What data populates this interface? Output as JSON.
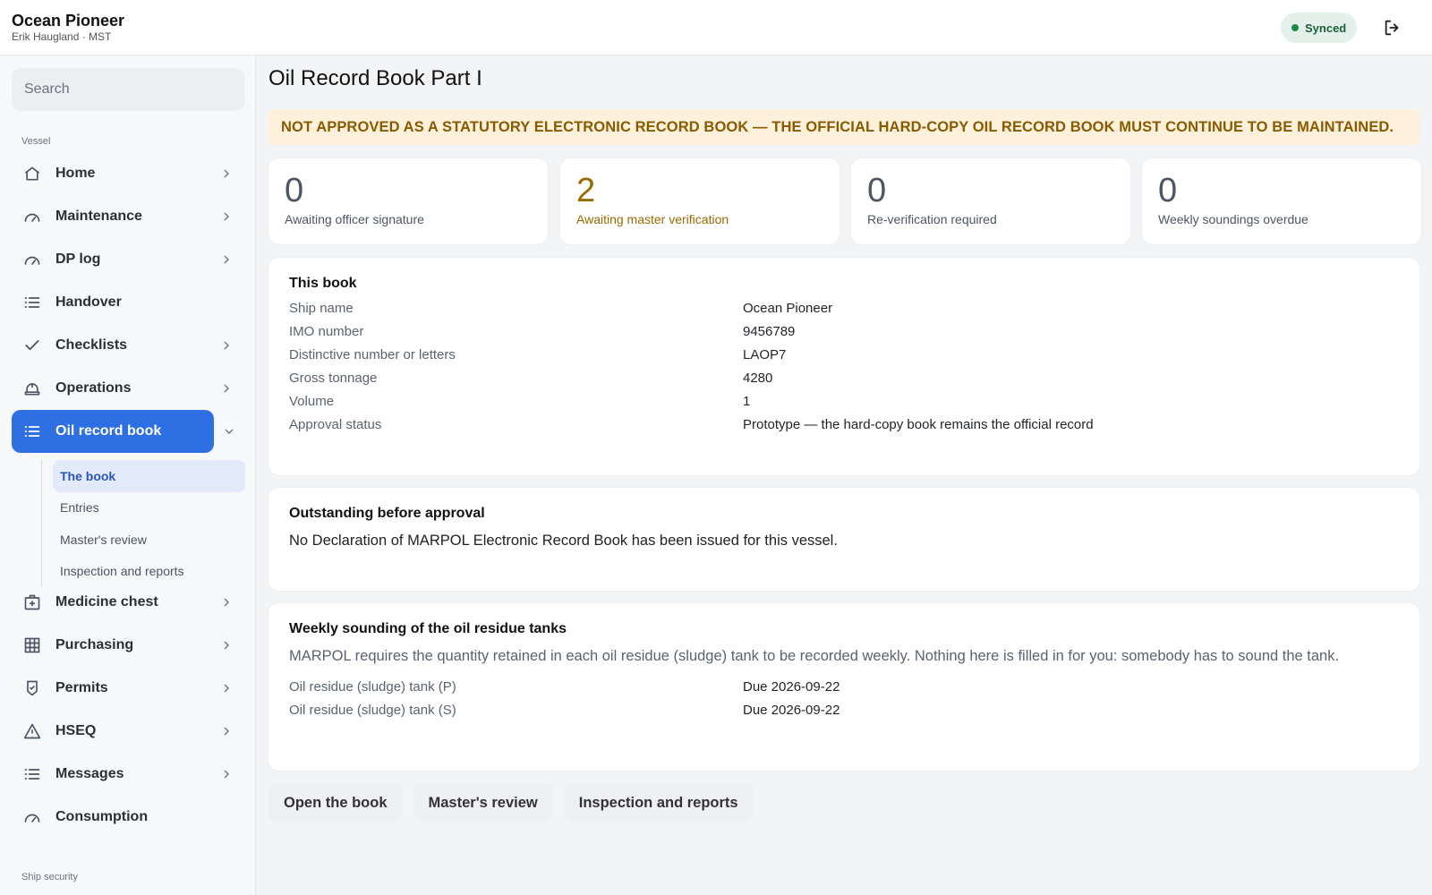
{
  "header": {
    "vessel_name": "Ocean Pioneer",
    "user_line": "Erik Haugland · MST",
    "sync_status": "Synced",
    "status_color": "#1f8a4c"
  },
  "sidebar": {
    "search_placeholder": "Search",
    "section_vessel": "Vessel",
    "section_ship_security": "Ship security",
    "items": [
      {
        "label": "Home",
        "icon": "home-icon"
      },
      {
        "label": "Maintenance",
        "icon": "gauge-icon"
      },
      {
        "label": "DP log",
        "icon": "gauge-icon"
      },
      {
        "label": "Handover",
        "icon": "list-icon"
      },
      {
        "label": "Checklists",
        "icon": "check-icon"
      },
      {
        "label": "Operations",
        "icon": "helmet-icon"
      },
      {
        "label": "Oil record book",
        "icon": "list-icon"
      },
      {
        "label": "Medicine chest",
        "icon": "medical-kit-icon"
      },
      {
        "label": "Purchasing",
        "icon": "grid-icon"
      },
      {
        "label": "Permits",
        "icon": "shield-icon"
      },
      {
        "label": "HSEQ",
        "icon": "warning-icon"
      },
      {
        "label": "Messages",
        "icon": "list-icon"
      },
      {
        "label": "Consumption",
        "icon": "gauge-icon"
      }
    ],
    "subitems": [
      "The book",
      "Entries",
      "Master's review",
      "Inspection and reports"
    ],
    "accent_color": "#2f6fe4"
  },
  "main": {
    "title": "Oil Record Book Part I",
    "banner": "NOT APPROVED AS A STATUTORY ELECTRONIC RECORD BOOK — THE OFFICIAL HARD-COPY OIL RECORD BOOK MUST CONTINUE TO BE MAINTAINED.",
    "stats": [
      {
        "value": "0",
        "label": "Awaiting officer signature"
      },
      {
        "value": "2",
        "label": "Awaiting master verification"
      },
      {
        "value": "0",
        "label": "Re-verification required"
      },
      {
        "value": "0",
        "label": "Weekly soundings overdue"
      }
    ],
    "this_book": {
      "title": "This book",
      "rows": [
        {
          "k": "Ship name",
          "v": "Ocean Pioneer"
        },
        {
          "k": "IMO number",
          "v": "9456789"
        },
        {
          "k": "Distinctive number or letters",
          "v": "LAOP7"
        },
        {
          "k": "Gross tonnage",
          "v": "4280"
        },
        {
          "k": "Volume",
          "v": "1"
        },
        {
          "k": "Approval status",
          "v": "Prototype — the hard-copy book remains the official record"
        }
      ]
    },
    "outstanding": {
      "title": "Outstanding before approval",
      "text": "No Declaration of MARPOL Electronic Record Book has been issued for this vessel."
    },
    "weekly": {
      "title": "Weekly sounding of the oil residue tanks",
      "text": "MARPOL requires the quantity retained in each oil residue (sludge) tank to be recorded weekly. Nothing here is filled in for you: somebody has to sound the tank.",
      "rows": [
        {
          "k": "Oil residue (sludge) tank (P)",
          "v": "Due 2026-09-22"
        },
        {
          "k": "Oil residue (sludge) tank (S)",
          "v": "Due 2026-09-22"
        }
      ]
    },
    "buttons": [
      "Open the book",
      "Master's review",
      "Inspection and reports"
    ],
    "warning_color": "#9a6a00"
  }
}
